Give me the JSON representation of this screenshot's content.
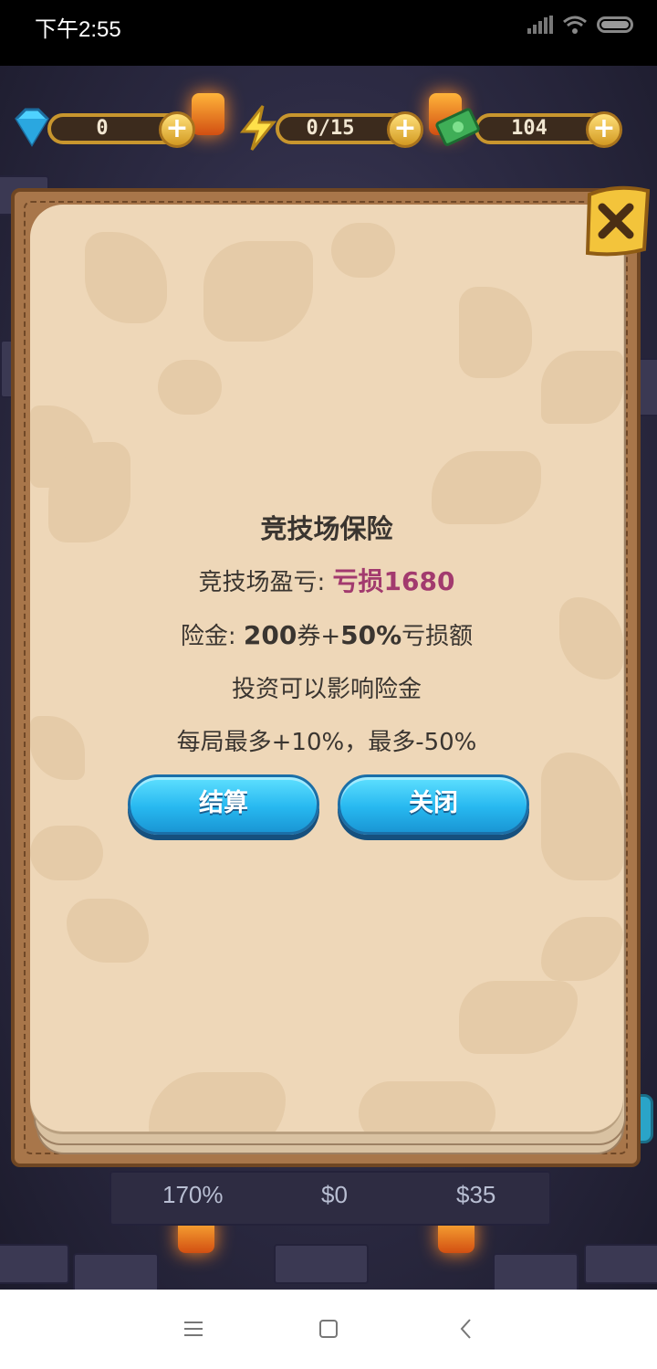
{
  "status_bar": {
    "time": "下午2:55"
  },
  "resources": {
    "gems": "0",
    "energy": "0/15",
    "cash": "104"
  },
  "bottom": {
    "val1": "170%",
    "val2": "$0",
    "val3": "$35"
  },
  "dialog": {
    "title": "竞技场保险",
    "profit_label": "竞技场盈亏: ",
    "profit_value": "亏损1680",
    "insurance_label": "险金: ",
    "insurance_amount": "200",
    "insurance_unit": "券+",
    "insurance_pct": "50%",
    "insurance_suffix": "亏损额",
    "invest_note": "投资可以影响险金",
    "limit_note": "每局最多+10%，最多-50%",
    "settle_button": "结算",
    "close_button": "关闭"
  },
  "colors": {
    "loss_text": "#a23a6e",
    "button_blue": "#27b8f0",
    "parchment": "#eed7b8"
  },
  "icons": {
    "gem": "diamond-icon",
    "energy": "lightning-icon",
    "cash": "cash-icon",
    "close": "close-icon"
  }
}
